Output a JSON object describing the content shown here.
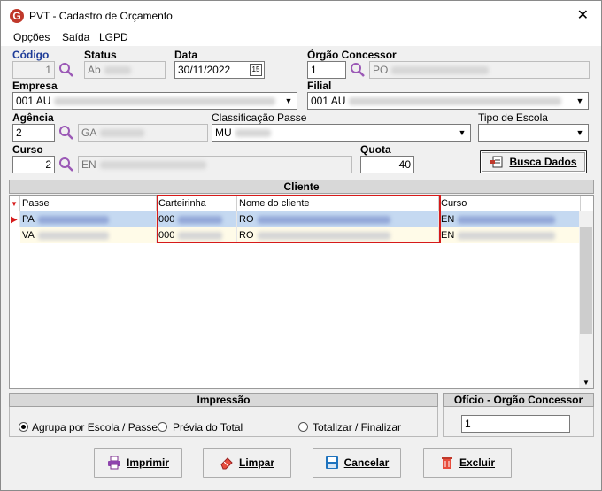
{
  "window": {
    "title": "PVT - Cadastro de Orçamento",
    "close_glyph": "✕",
    "logo_glyph": "G"
  },
  "menu": [
    "Opções",
    "Saída",
    "LGPD"
  ],
  "form": {
    "codigo": {
      "label": "Código",
      "value": "1"
    },
    "status": {
      "label": "Status",
      "value": "Ab"
    },
    "data": {
      "label": "Data",
      "value": "30/11/2022",
      "cal_glyph": "15"
    },
    "orgao": {
      "label": "Órgão Concessor",
      "code": "1",
      "name": "PO"
    },
    "empresa": {
      "label": "Empresa",
      "value": "001 AU"
    },
    "filial": {
      "label": "Filial",
      "value": "001 AU"
    },
    "agencia": {
      "label": "Agência",
      "code": "2",
      "name": "GA"
    },
    "classificacao": {
      "label": "Classificação Passe",
      "value": "MU"
    },
    "tipo_escola": {
      "label": "Tipo de Escola",
      "value": ""
    },
    "curso": {
      "label": "Curso",
      "code": "2",
      "name": "EN"
    },
    "quota": {
      "label": "Quota",
      "value": "40"
    },
    "busca_button": "Busca Dados"
  },
  "cliente": {
    "section_title": "Cliente",
    "columns": [
      "Passe",
      "Carteirinha",
      "Nome do cliente",
      "Curso"
    ],
    "rows": [
      {
        "passe": "PA",
        "carteirinha": "000",
        "nome": "RO",
        "curso": "EN",
        "selected": true
      },
      {
        "passe": "VA",
        "carteirinha": "000",
        "nome": "RO",
        "curso": "EN",
        "selected": false
      }
    ]
  },
  "impressao": {
    "title": "Impressão",
    "options": [
      "Agrupa por Escola / Passe",
      "Prévia do Total",
      "Totalizar / Finalizar"
    ],
    "selected_index": 0
  },
  "oficio": {
    "title": "Ofício - Orgão Concessor",
    "value": "1"
  },
  "buttons": {
    "imprimir": "Imprimir",
    "limpar": "Limpar",
    "cancelar": "Cancelar",
    "excluir": "Excluir"
  },
  "colors": {
    "label_blue": "#1f3d99",
    "selection": "#c5d9f1",
    "highlight_box": "#d61a1a",
    "magnifier": "#9b59b6"
  }
}
